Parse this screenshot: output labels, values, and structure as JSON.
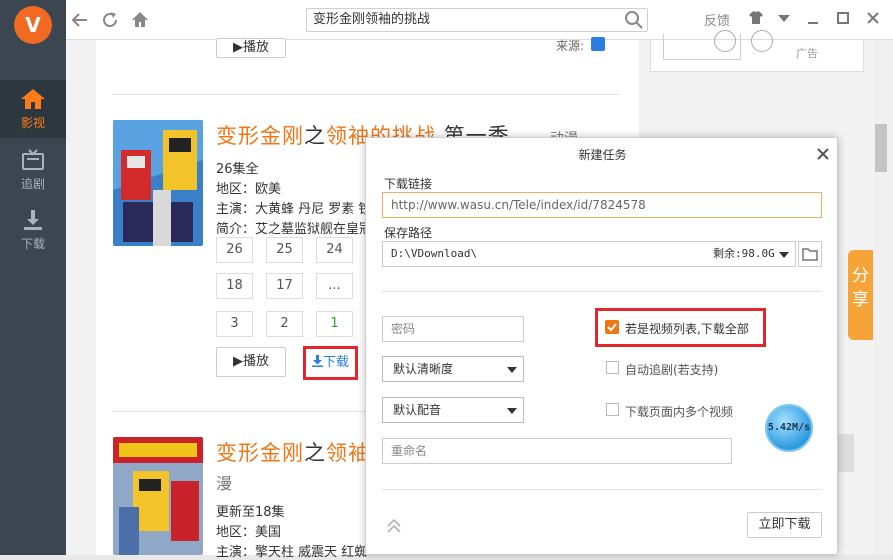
{
  "sidebar": {
    "logo": "V",
    "items": [
      {
        "label": "影视",
        "icon": "home-icon",
        "active": true
      },
      {
        "label": "追剧",
        "icon": "tv-icon",
        "active": false
      },
      {
        "label": "下载",
        "icon": "download-icon",
        "active": false
      }
    ]
  },
  "topbar": {
    "search_value": "变形金刚领袖的挑战",
    "feedback": "反馈"
  },
  "content": {
    "top_play_label": "▶播放",
    "top_source_label": "来源:",
    "ad_label": "广告",
    "item1": {
      "title_p1": "变形金刚",
      "title_p2": "之",
      "title_p3": "领袖的挑战",
      "title_p4": " 第一季",
      "type": "动漫",
      "episodes": "26集全",
      "region": "地区：欧美",
      "cast": "主演：大黄蜂 丹尼 罗素 铁",
      "intro": "简介：艾之墓监狱舰在皇冠",
      "ep_rows": [
        [
          "26",
          "25",
          "24"
        ],
        [
          "18",
          "17",
          "..."
        ],
        [
          "3",
          "2",
          "1"
        ]
      ],
      "play_label": "▶播放",
      "download_label": "下载"
    },
    "item2": {
      "title_p1": "变形金刚",
      "title_p2": "之",
      "title_p3": "领袖",
      "type_cont": "漫",
      "update": "更新至18集",
      "region": "地区：美国",
      "cast": "主演：擎天柱 威震天 红蜘"
    }
  },
  "share_label": "分享",
  "dialog": {
    "title": "新建任务",
    "url_label": "下载链接",
    "url_value": "http://www.wasu.cn/Tele/index/id/7824578",
    "path_label": "保存路径",
    "path_value": "D:\\VDownload\\",
    "free_space": "剩余:98.0G",
    "password_placeholder": "密码",
    "quality_select": "默认清晰度",
    "audio_select": "默认配音",
    "rename_placeholder": "重命名",
    "opt_download_all": "若是视频列表,下载全部",
    "opt_auto_follow": "自动追剧(若支持)",
    "opt_multi_video": "下载页面内多个视频",
    "speed": "5.42M/s",
    "download_now": "立即下载"
  },
  "colors": {
    "accent": "#f07515",
    "highlight": "#e3262c",
    "sidebar": "#3b4650"
  }
}
